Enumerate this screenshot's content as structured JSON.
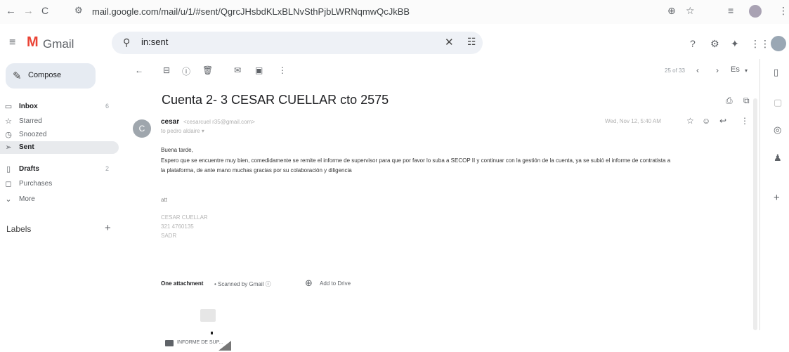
{
  "browser": {
    "url": "mail.google.com/mail/u/1/#sent/QgrcJHsbdKLxBLNvSthPjbLWRNqmwQcJkBB",
    "nav_back": "←",
    "nav_forward": "→",
    "reload": "C"
  },
  "app": {
    "menu_glyph": "≡",
    "logo_letter": "M",
    "name": "Gmail"
  },
  "search": {
    "value": "in:sent"
  },
  "compose": {
    "label": "Compose"
  },
  "sidebar": {
    "items": [
      {
        "label": "Inbox",
        "count": "6",
        "icon": "▭"
      },
      {
        "label": "Starred",
        "count": "",
        "icon": "☆"
      },
      {
        "label": "Snoozed",
        "count": "",
        "icon": "◷"
      },
      {
        "label": "Sent",
        "count": "",
        "icon": "➢"
      },
      {
        "label": "Drafts",
        "count": "2",
        "icon": "▯"
      },
      {
        "label": "Purchases",
        "count": "",
        "icon": "◻"
      },
      {
        "label": "More",
        "count": "",
        "icon": "⌄"
      }
    ],
    "labels_heading": "Labels",
    "labels_add": "+"
  },
  "toolbar": {
    "pager": "25 of 33",
    "lang": "Es"
  },
  "message": {
    "subject": "Cuenta 2- 3 CESAR CUELLAR cto 2575",
    "sender_initial": "C",
    "sender_name": "cesar",
    "sender_email": "<cesarcuel r35@gmail.com>",
    "recipient": "to pedro aldaire ▾",
    "date": "Wed, Nov 12, 5:40 AM",
    "greeting": "Buena tarde,",
    "body_line1": "Espero que se encuentre muy bien, comedidamente se remite el informe de supervisor para que por favor lo suba a SECOP II y continuar con la gestión de la cuenta, ya se subió el informe de contratista a",
    "body_line2": "la plataforma, de ante mano muchas gracias por su colaboración y diligencia",
    "signature": {
      "att": "att",
      "name": "CESAR CUELLAR",
      "phone": "321 4760135",
      "org": "SADR"
    }
  },
  "attachments": {
    "count_label": "One attachment",
    "scanned_label": "• Scanned by Gmail ⓘ",
    "add_drive_label": "Add to Drive",
    "file_name": "INFORME DE SUP..."
  }
}
